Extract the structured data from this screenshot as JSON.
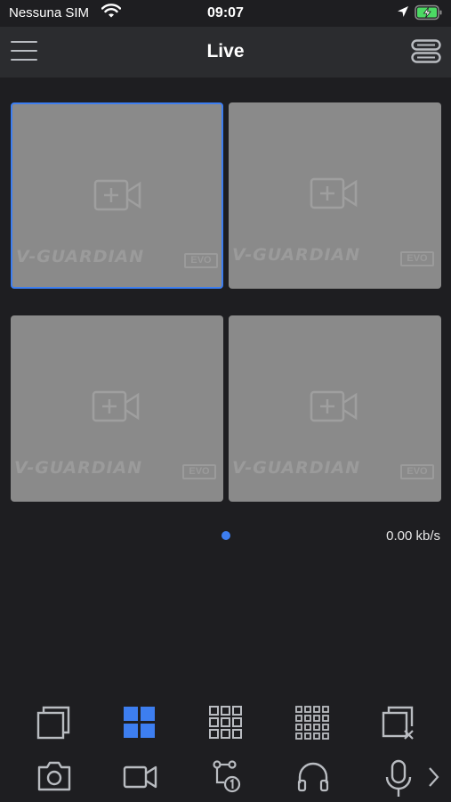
{
  "status_bar": {
    "carrier": "Nessuna SIM",
    "time": "09:07"
  },
  "header": {
    "title": "Live"
  },
  "tiles": [
    {
      "brand": "V-GUARDIAN",
      "badge": "EVO",
      "selected": true
    },
    {
      "brand": "V-GUARDIAN",
      "badge": "EVO",
      "selected": false
    },
    {
      "brand": "V-GUARDIAN",
      "badge": "EVO",
      "selected": false
    },
    {
      "brand": "V-GUARDIAN",
      "badge": "EVO",
      "selected": false
    }
  ],
  "pager": {
    "current_page": 1,
    "page_count": 1
  },
  "bitrate": "0.00 kb/s",
  "colors": {
    "accent": "#3d7ef0",
    "background": "#1e1e21",
    "header": "#2b2c2f",
    "tile": "#8a8a8a",
    "icon": "#b9bcc1"
  },
  "toolbar_layouts": [
    "single-view-icon",
    "grid-4-icon",
    "grid-9-icon",
    "grid-16-icon",
    "close-all-icon"
  ],
  "toolbar_actions": [
    "snapshot-icon",
    "record-icon",
    "ptz-icon",
    "audio-icon",
    "microphone-icon",
    "chevron-right-icon"
  ]
}
